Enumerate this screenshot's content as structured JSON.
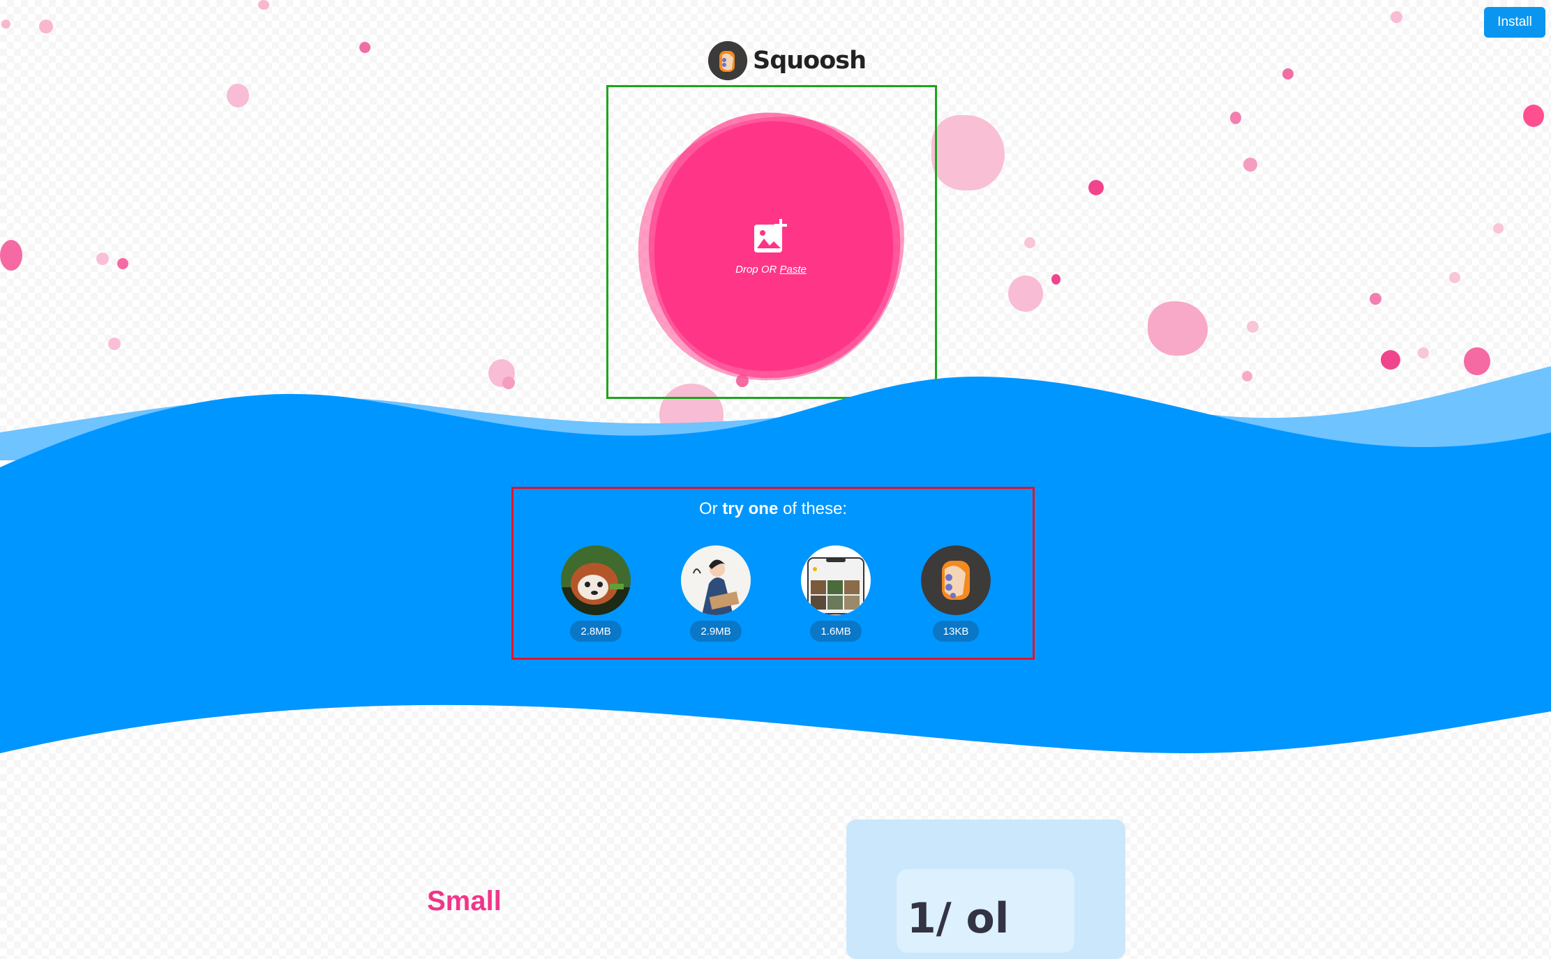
{
  "header": {
    "install_label": "Install"
  },
  "logo": {
    "name": "Squoosh"
  },
  "dropzone": {
    "prefix": "Drop OR",
    "paste_label": "Paste"
  },
  "demos": {
    "title_prefix": "Or",
    "title_bold": "try one",
    "title_suffix": "of these:",
    "items": [
      {
        "size": "2.8MB"
      },
      {
        "size": "2.9MB"
      },
      {
        "size": "1.6MB"
      },
      {
        "size": "13KB"
      }
    ]
  },
  "feature": {
    "title": "Small",
    "card_text": "1/ ol"
  },
  "colors": {
    "accent_pink": "#ff3385",
    "wave_blue": "#0096ff",
    "wave_light": "#6fc3ff",
    "install_blue": "#0a96f0"
  }
}
